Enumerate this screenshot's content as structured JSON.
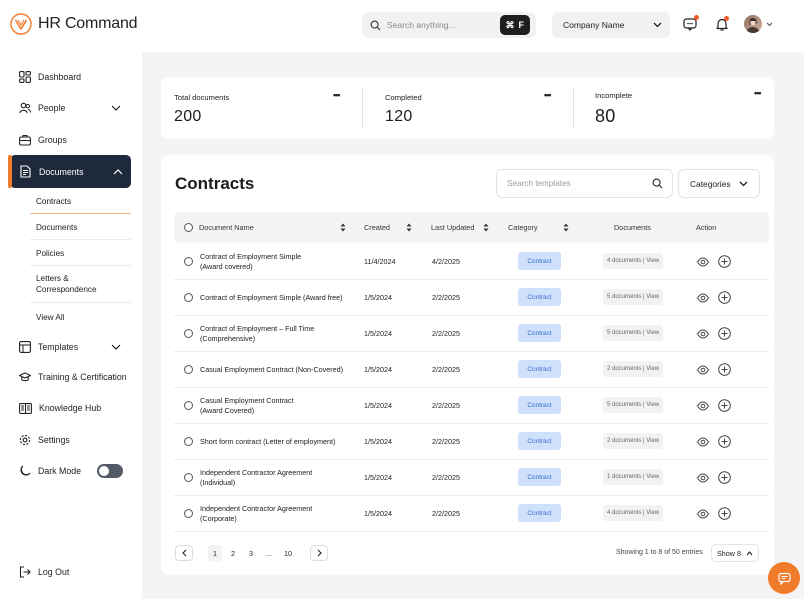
{
  "app": {
    "name": "HR Command"
  },
  "header": {
    "search_placeholder": "Search anything...",
    "shortcut_symbol": "⌘",
    "shortcut_key": "F",
    "company_select": "Company Name"
  },
  "sidebar": {
    "items": [
      {
        "label": "Dashboard",
        "icon": "dashboard-icon"
      },
      {
        "label": "People",
        "icon": "people-icon"
      },
      {
        "label": "Groups",
        "icon": "groups-icon"
      },
      {
        "label": "Documents",
        "icon": "documents-icon"
      },
      {
        "label": "Templates",
        "icon": "templates-icon"
      },
      {
        "label": "Training & Certification",
        "icon": "training-icon"
      },
      {
        "label": "Knowledge Hub",
        "icon": "knowledge-icon"
      },
      {
        "label": "Settings",
        "icon": "gear-icon"
      },
      {
        "label": "Dark Mode",
        "icon": "moon-icon"
      },
      {
        "label": "Log Out",
        "icon": "logout-icon"
      }
    ],
    "documents_sub": [
      "Contracts",
      "Documents",
      "Policies",
      "Letters &",
      "Correspondence",
      "View All"
    ]
  },
  "stats": [
    {
      "label": "Total documents",
      "value": "200"
    },
    {
      "label": "Completed",
      "value": "120"
    },
    {
      "label": "Incomplete",
      "value": "80"
    }
  ],
  "contracts": {
    "title": "Contracts",
    "search_placeholder": "Search templates",
    "categories_label": "Categories",
    "columns": [
      "Document Name",
      "Created",
      "Last Updated",
      "Category",
      "Documents",
      "Action"
    ],
    "rows": [
      {
        "name1": "Contract of Employment Simple",
        "name2": "(Award covered)",
        "created": "11/4/2024",
        "updated": "4/2/2025",
        "category": "Contract",
        "docs": "4 documents | View"
      },
      {
        "name1": "Contract of Employment Simple (Award free)",
        "name2": "",
        "created": "1/5/2024",
        "updated": "2/2/2025",
        "category": "Contract",
        "docs": "5 documents | View"
      },
      {
        "name1": "Contract of Employment – Full Time",
        "name2": "(Comprehensive)",
        "created": "1/5/2024",
        "updated": "2/2/2025",
        "category": "Contract",
        "docs": "5 documents | View"
      },
      {
        "name1": "Casual Employment Contract (Non-Covered)",
        "name2": "",
        "created": "1/5/2024",
        "updated": "2/2/2025",
        "category": "Contract",
        "docs": "2 documents | View"
      },
      {
        "name1": "Casual Employment Contract",
        "name2": "(Award Covered)",
        "created": "1/5/2024",
        "updated": "2/2/2025",
        "category": "Contract",
        "docs": "5 documents | View"
      },
      {
        "name1": "Short form contract (Letter of employment)",
        "name2": "",
        "created": "1/5/2024",
        "updated": "2/2/2025",
        "category": "Contract",
        "docs": "2 documents | View"
      },
      {
        "name1": "Independent Contractor Agreement",
        "name2": "(Individual)",
        "created": "1/5/2024",
        "updated": "2/2/2025",
        "category": "Contract",
        "docs": "1 documents | View"
      },
      {
        "name1": "Independent Contractor Agreement",
        "name2": "(Corporate)",
        "created": "1/5/2024",
        "updated": "2/2/2025",
        "category": "Contract",
        "docs": "4 documents | View"
      }
    ],
    "pagination": {
      "pages": [
        "1",
        "2",
        "3",
        "...",
        "10"
      ],
      "showing": "Showing 1 to 8 of 50 entries",
      "show": "Show 8"
    }
  },
  "colors": {
    "accent": "#F07B2A",
    "nav_active": "#1E2A3B",
    "badge_bg": "#CFE0FB",
    "badge_text": "#3B6DD8"
  }
}
